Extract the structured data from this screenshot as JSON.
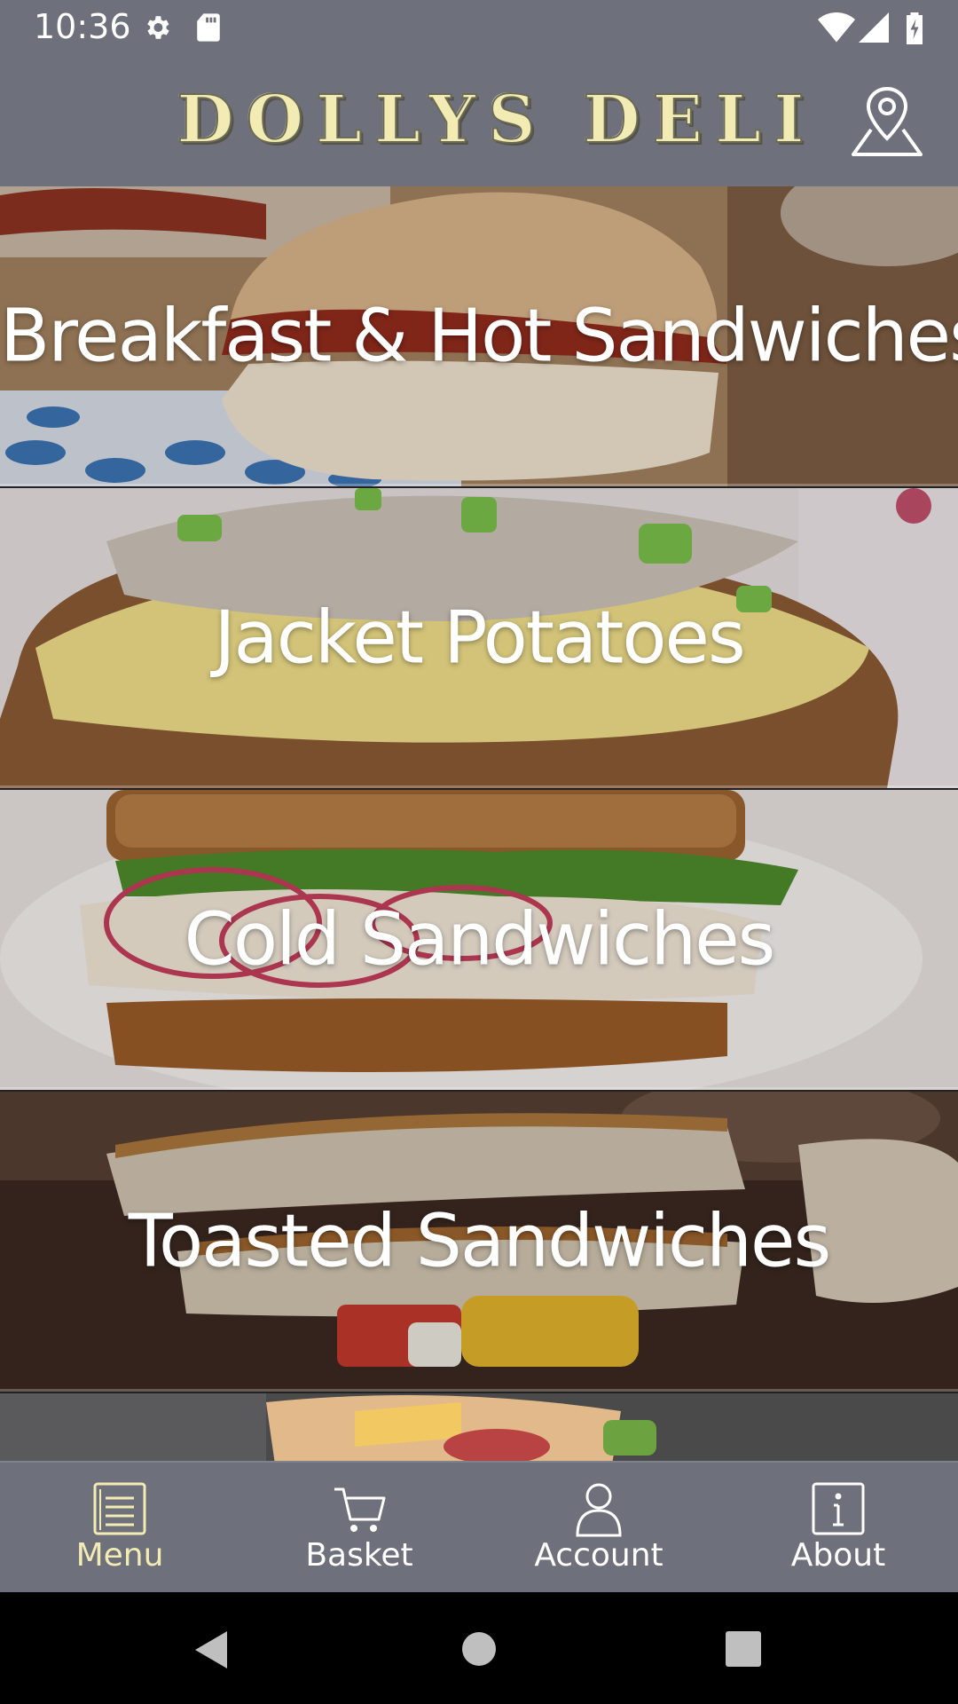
{
  "status_bar": {
    "time": "10:36"
  },
  "header": {
    "logo_text": "DOLLYS DELI"
  },
  "categories": [
    {
      "label": "Breakfast & Hot Sandwiches"
    },
    {
      "label": "Jacket Potatoes"
    },
    {
      "label": "Cold Sandwiches"
    },
    {
      "label": "Toasted Sandwiches"
    },
    {
      "label": ""
    }
  ],
  "bottom_nav": {
    "items": [
      {
        "label": "Menu",
        "icon": "menu-list-icon",
        "active": true
      },
      {
        "label": "Basket",
        "icon": "basket-icon",
        "active": false
      },
      {
        "label": "Account",
        "icon": "account-icon",
        "active": false
      },
      {
        "label": "About",
        "icon": "info-icon",
        "active": false
      }
    ]
  },
  "colors": {
    "bar_background": "#6e707b",
    "accent": "#f2ecb4",
    "label_text": "#ffffff"
  }
}
